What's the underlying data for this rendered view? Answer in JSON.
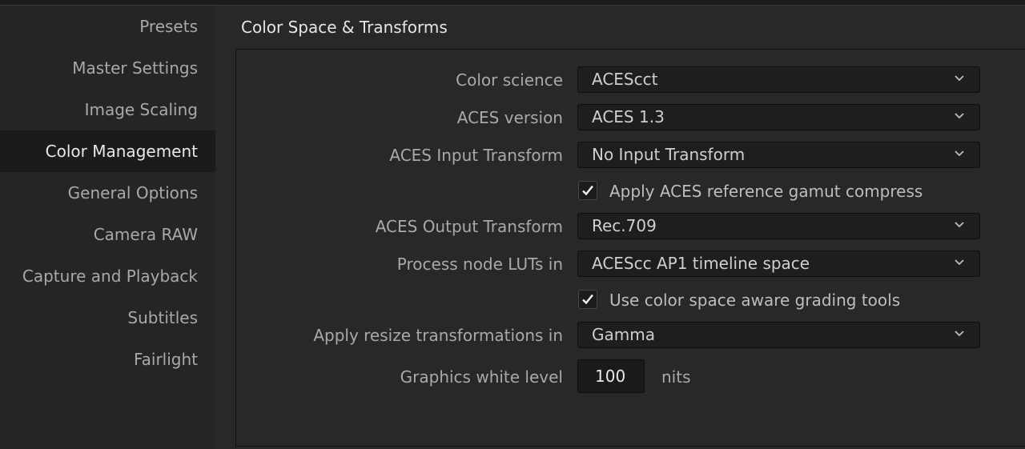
{
  "sidebar": {
    "items": [
      {
        "label": "Presets"
      },
      {
        "label": "Master Settings"
      },
      {
        "label": "Image Scaling"
      },
      {
        "label": "Color Management",
        "active": true
      },
      {
        "label": "General Options"
      },
      {
        "label": "Camera RAW"
      },
      {
        "label": "Capture and Playback"
      },
      {
        "label": "Subtitles"
      },
      {
        "label": "Fairlight"
      }
    ]
  },
  "section": {
    "title": "Color Space & Transforms"
  },
  "fields": {
    "color_science": {
      "label": "Color science",
      "value": "ACEScct"
    },
    "aces_version": {
      "label": "ACES version",
      "value": "ACES 1.3"
    },
    "aces_input_transform": {
      "label": "ACES Input Transform",
      "value": "No Input Transform"
    },
    "gamut_compress": {
      "label": "Apply ACES reference gamut compress",
      "checked": true
    },
    "aces_output_transform": {
      "label": "ACES Output Transform",
      "value": "Rec.709"
    },
    "process_node_luts": {
      "label": "Process node LUTs in",
      "value": "ACEScc AP1 timeline space"
    },
    "color_space_aware": {
      "label": "Use color space aware grading tools",
      "checked": true
    },
    "resize_transformations": {
      "label": "Apply resize transformations in",
      "value": "Gamma"
    },
    "graphics_white_level": {
      "label": "Graphics white level",
      "value": "100",
      "unit": "nits"
    }
  },
  "icons": {
    "dropdown": "chevron-down-icon",
    "check": "checkmark-icon"
  },
  "colors": {
    "background": "#282828",
    "sidebar_active": "#1b1b1b",
    "field_background": "#1e1e1e"
  }
}
